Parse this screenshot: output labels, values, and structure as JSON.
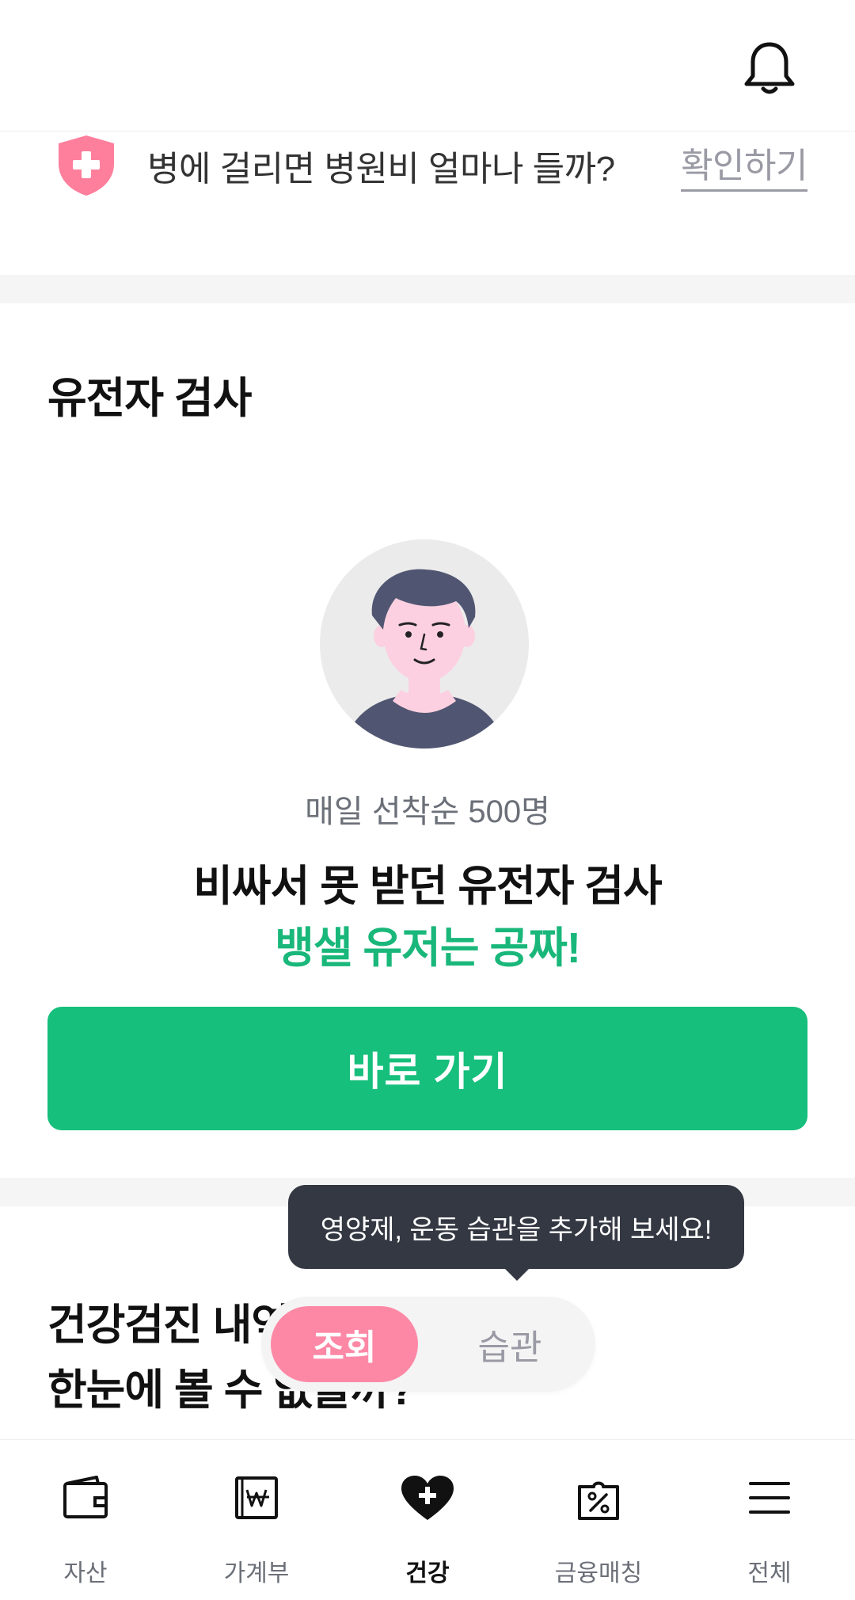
{
  "banner": {
    "text": "병에 걸리면 병원비 얼마나 들까?",
    "link_label": "확인하기"
  },
  "genetic_section": {
    "title": "유전자 검사",
    "sub_caption": "매일 선착순 500명",
    "main_caption": "비싸서 못 받던 유전자 검사",
    "highlight_caption": "뱅샐 유저는 공짜!",
    "cta_label": "바로 가기"
  },
  "checkup_section": {
    "title_line1": "건강검진 내역",
    "title_line2": "한눈에 볼 수 없을까?"
  },
  "tooltip": {
    "text": "영양제, 운동 습관을 추가해 보세요!"
  },
  "toggle": {
    "options": [
      "조회",
      "습관"
    ],
    "selected": "조회"
  },
  "bottom_nav": {
    "items": [
      {
        "label": "자산",
        "icon": "wallet-icon"
      },
      {
        "label": "가계부",
        "icon": "ledger-icon"
      },
      {
        "label": "건강",
        "icon": "heart-plus-icon"
      },
      {
        "label": "금융매칭",
        "icon": "coupon-icon"
      },
      {
        "label": "전체",
        "icon": "menu-icon"
      }
    ],
    "active": "건강"
  },
  "colors": {
    "accent_green": "#16bf7c",
    "accent_pink": "#fd88a6",
    "tooltip_bg": "#333842"
  }
}
